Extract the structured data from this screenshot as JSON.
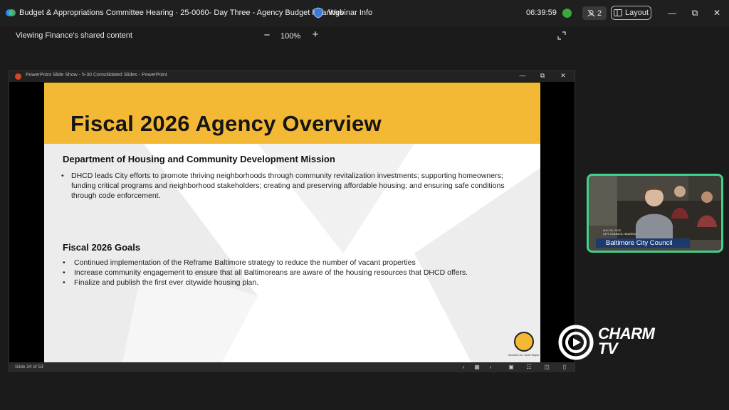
{
  "window": {
    "meeting_title": "Budget & Appropriations Committee Hearing · 25-0060- Day Three - Agency Budget Hearings",
    "webinar_info": "Webinar Info",
    "timer": "06:39:59",
    "participants_count": "2",
    "layout_label": "Layout"
  },
  "share": {
    "label": "Viewing Finance's shared content",
    "zoom": "100%"
  },
  "ppt": {
    "title": "PowerPoint Slide Show  -  5-30 Consolidated Slides - PowerPoint",
    "slide_count": "Slide 34 of 53"
  },
  "slide": {
    "title": "Fiscal 2026 Agency Overview",
    "mission_heading": "Department of Housing and Community Development Mission",
    "mission_text": "DHCD leads City efforts to promote thriving neighborhoods through community revitalization investments; supporting homeowners; funding critical programs and neighborhood stakeholders; creating and preserving affordable housing; and ensuring safe conditions through code enforcement.",
    "goals_heading": "Fiscal 2026 Goals",
    "goals": [
      "Continued implementation of the Reframe Baltimore strategy to reduce the number of vacant properties",
      "Increase community engagement to ensure that all Baltimoreans are aware of the housing resources that DHCD offers.",
      "Finalize and publish the first ever citywide housing plan."
    ],
    "seal_caption": "Brandon M. Scott Mayor"
  },
  "video": {
    "lower_third": "Baltimore City Council",
    "lower_third_small": "CITY COUNCIL HEARING",
    "date": "MAY 30, 2025"
  },
  "branding": {
    "line1": "CHARM",
    "line2": "TV"
  },
  "colors": {
    "slide_header": "#f4b934",
    "video_border": "#3fd28a",
    "recording_dot": "#3aa83a"
  }
}
